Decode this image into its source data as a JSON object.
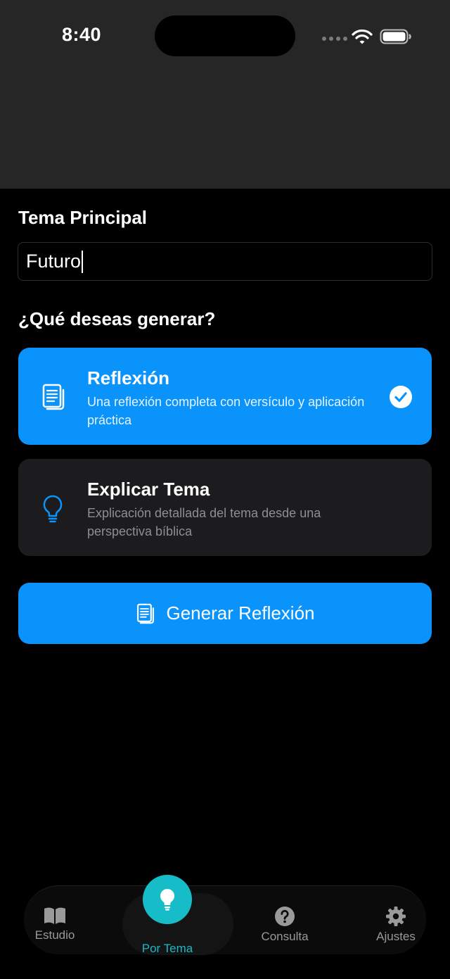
{
  "status_bar": {
    "time": "8:40"
  },
  "form": {
    "topic_label": "Tema Principal",
    "topic_value": "Futuro",
    "generate_question": "¿Qué deseas generar?"
  },
  "options": [
    {
      "title": "Reflexión",
      "description": "Una reflexión completa con versículo y aplicación práctica",
      "icon": "document-icon",
      "selected": true
    },
    {
      "title": "Explicar Tema",
      "description": "Explicación detallada del tema desde una perspectiva bíblica",
      "icon": "lightbulb-icon",
      "selected": false
    }
  ],
  "generate_button": {
    "label": "Generar Reflexión",
    "icon": "document-icon"
  },
  "tabbar": {
    "items": [
      {
        "label": "Estudio",
        "icon": "book-icon"
      },
      {
        "label": "Por Tema",
        "icon": "lightbulb-icon",
        "active": true
      },
      {
        "label": "Consulta",
        "icon": "question-icon"
      },
      {
        "label": "Ajustes",
        "icon": "gear-icon"
      }
    ]
  },
  "colors": {
    "accent": "#0a93fb",
    "active_tab": "#17bcc9",
    "card": "#1c1c1e",
    "header": "#262626"
  }
}
